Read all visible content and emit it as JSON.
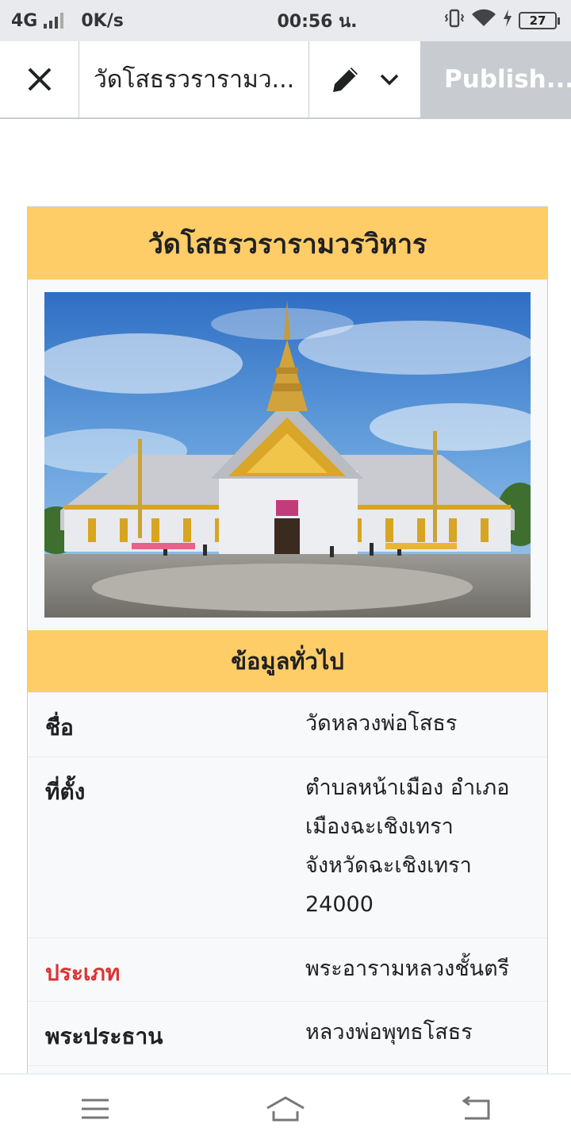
{
  "status_bar": {
    "network": "4G",
    "speed": "0K/s",
    "time": "00:56 น.",
    "battery": "27",
    "icons": [
      "signal-icon",
      "vibrate-icon",
      "wifi-icon",
      "charging-icon",
      "battery-icon"
    ]
  },
  "toolbar": {
    "close_icon": "close-icon",
    "page_title": "วัดโสธรวรารามว...",
    "edit_icon": "pencil-icon",
    "dropdown_icon": "chevron-down-icon",
    "publish_label": "Publish..."
  },
  "infobox": {
    "title": "วัดโสธรวรารามวรวิหาร",
    "image_alt": "temple-photo",
    "section_heading": "ข้อมูลทั่วไป",
    "rows": [
      {
        "label": "ชื่อ",
        "value": "วัดหลวงพ่อโสธร",
        "is_link": false
      },
      {
        "label": "ที่ตั้ง",
        "value_lines": [
          "ตำบลหน้าเมือง อำเภอ",
          "เมืองฉะเชิงเทรา",
          "จังหวัดฉะเชิงเทรา",
          "24000"
        ],
        "is_link": false
      },
      {
        "label": "ประเภท",
        "value": "พระอารามหลวงชั้นตรี",
        "is_link": true
      },
      {
        "label": "พระประธาน",
        "value": "หลวงพ่อพุทธโสธร",
        "is_link": false
      }
    ]
  },
  "colors": {
    "header_bg": "#ffcd68",
    "link": "#d33333",
    "publish_bg": "#c8ccd1",
    "status_bg": "#e8eaed"
  },
  "nav_bar": {
    "icons": [
      "menu-icon",
      "home-icon",
      "back-icon"
    ]
  }
}
